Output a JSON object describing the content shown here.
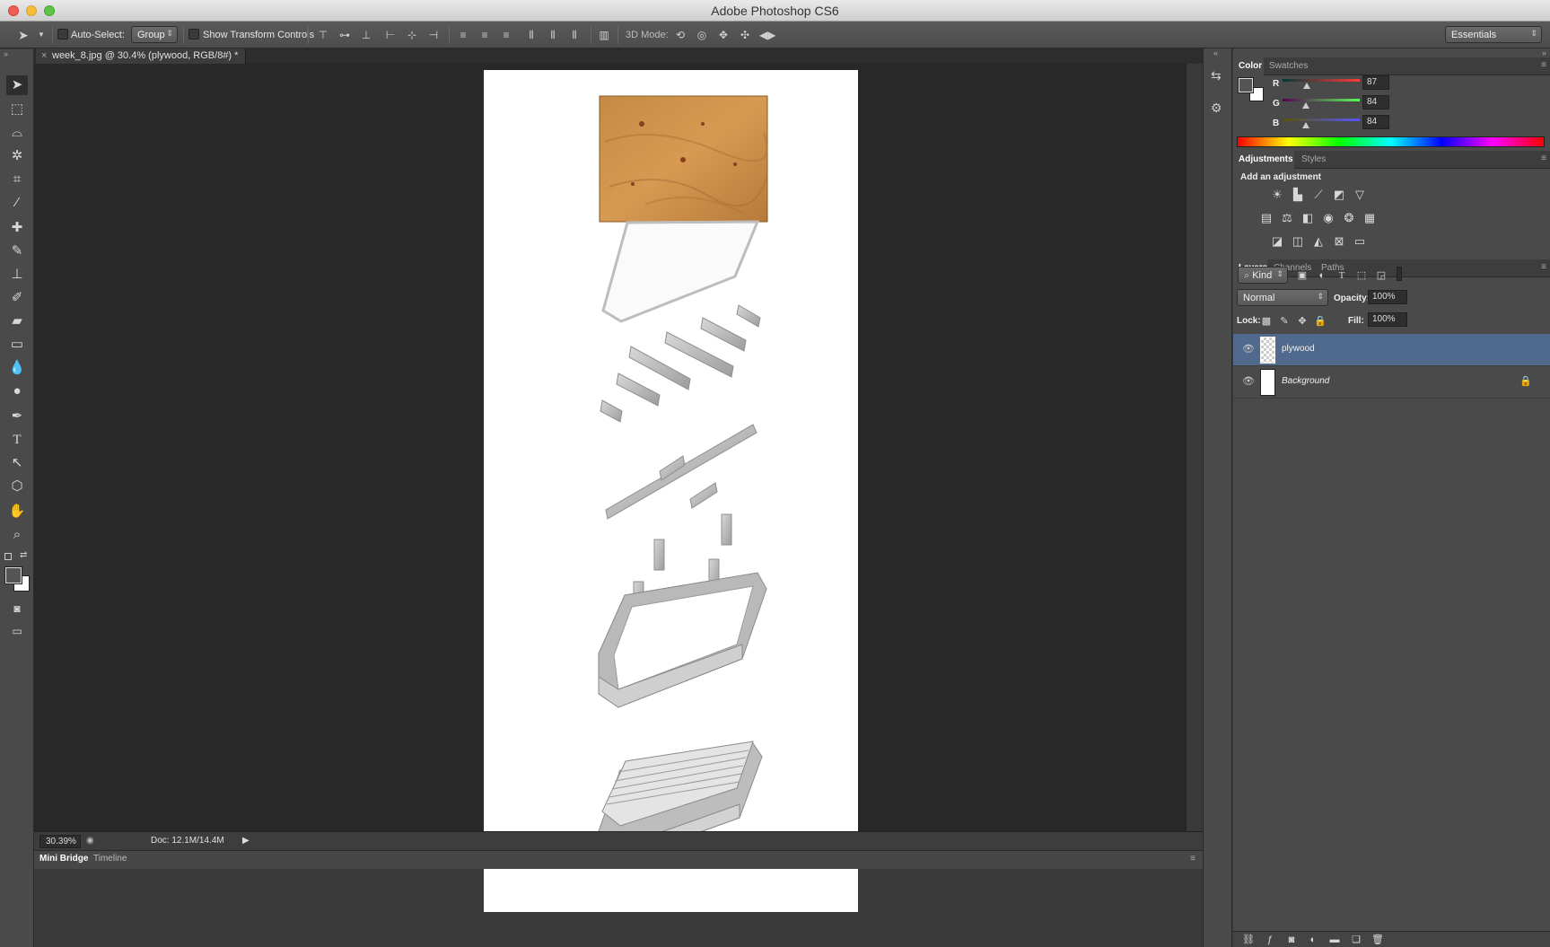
{
  "app": {
    "title": "Adobe Photoshop CS6"
  },
  "options": {
    "auto_select_label": "Auto-Select:",
    "auto_select_value": "Group",
    "show_transform_label": "Show Transform Controls",
    "mode3d_label": "3D Mode:",
    "workspace": "Essentials"
  },
  "document": {
    "tab_label": "week_8.jpg @ 30.4% (plywood, RGB/8#) *"
  },
  "status": {
    "zoom": "30.39%",
    "doc_size": "Doc: 12.1M/14.4M"
  },
  "bottom_tabs": [
    "Mini Bridge",
    "Timeline"
  ],
  "color_panel": {
    "tabs": [
      "Color",
      "Swatches"
    ],
    "channels": [
      {
        "label": "R",
        "value": "87"
      },
      {
        "label": "G",
        "value": "84"
      },
      {
        "label": "B",
        "value": "84"
      }
    ]
  },
  "adjustments_panel": {
    "tabs": [
      "Adjustments",
      "Styles"
    ],
    "heading": "Add an adjustment"
  },
  "layers_panel": {
    "tabs": [
      "Layers",
      "Channels",
      "Paths"
    ],
    "filter": "Kind",
    "blend_mode": "Normal",
    "opacity_label": "Opacity:",
    "opacity": "100%",
    "lock_label": "Lock:",
    "fill_label": "Fill:",
    "fill": "100%",
    "layers": [
      {
        "name": "plywood",
        "selected": true
      },
      {
        "name": "Background",
        "selected": false
      }
    ]
  }
}
